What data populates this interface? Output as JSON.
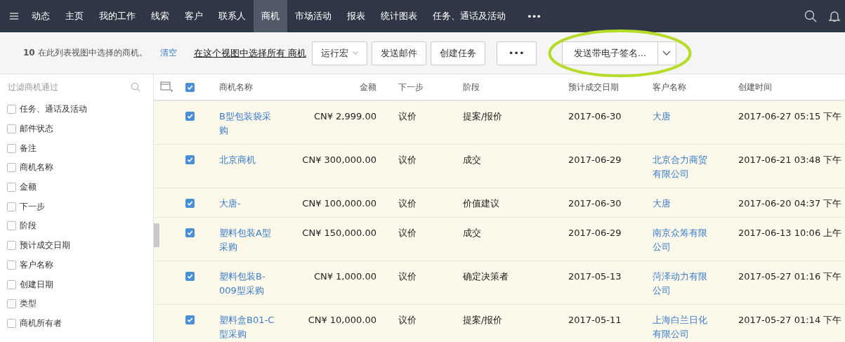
{
  "nav": {
    "items": [
      {
        "label": "动态",
        "selected": false
      },
      {
        "label": "主页",
        "selected": false
      },
      {
        "label": "我的工作",
        "selected": false
      },
      {
        "label": "线索",
        "selected": false
      },
      {
        "label": "客户",
        "selected": false
      },
      {
        "label": "联系人",
        "selected": false
      },
      {
        "label": "商机",
        "selected": true
      },
      {
        "label": "市场活动",
        "selected": false
      },
      {
        "label": "报表",
        "selected": false
      },
      {
        "label": "统计图表",
        "selected": false
      },
      {
        "label": "任务、通话及活动",
        "selected": false
      }
    ],
    "more": "•••"
  },
  "toolbar": {
    "selection_text": "**10** 在此列表视图中选择的商机。",
    "clear_link": "清空",
    "select_all_link": "在这个视图中选择所有 商机",
    "buttons": [
      {
        "label": "运行宏",
        "kind": "dropdown"
      },
      {
        "label": "发送邮件",
        "kind": "plain"
      },
      {
        "label": "创建任务",
        "kind": "plain"
      },
      {
        "label": "•••",
        "kind": "more"
      },
      {
        "label": "发送带电子签名...",
        "kind": "split"
      }
    ]
  },
  "sidebar": {
    "filter_placeholder": "过滤商机通过",
    "fields": [
      {
        "label": "任务、通话及活动",
        "checked": false
      },
      {
        "label": "邮件状态",
        "checked": false
      },
      {
        "label": "备注",
        "checked": false
      },
      {
        "label": "商机名称",
        "checked": false
      },
      {
        "label": "金额",
        "checked": false
      },
      {
        "label": "下一步",
        "checked": false
      },
      {
        "label": "阶段",
        "checked": false
      },
      {
        "label": "预计成交日期",
        "checked": false
      },
      {
        "label": "客户名称",
        "checked": false
      },
      {
        "label": "创建日期",
        "checked": false
      },
      {
        "label": "类型",
        "checked": false
      },
      {
        "label": "商机所有者",
        "checked": false
      }
    ]
  },
  "table": {
    "all_checked": true,
    "columns": [
      "商机名称",
      "金额",
      "下一步",
      "阶段",
      "预计成交日期",
      "客户名称",
      "创建时间"
    ],
    "rows": [
      {
        "checked": true,
        "name": "B型包装袋采购",
        "amount": "CN¥ 2,999.00",
        "next_step": "议价",
        "stage": "提案/报价",
        "close_date": "2017-06-30",
        "customer": "大唐",
        "created": "2017-06-27 05:15 下午"
      },
      {
        "checked": true,
        "name": "北京商机",
        "amount": "CN¥ 300,000.00",
        "next_step": "议价",
        "stage": "成交",
        "close_date": "2017-06-29",
        "customer": "北京合力商贸有限公司",
        "created": "2017-06-21 03:48 下午"
      },
      {
        "checked": true,
        "name": "大唐-",
        "amount": "CN¥ 100,000.00",
        "next_step": "议价",
        "stage": "价值建议",
        "close_date": "2017-06-30",
        "customer": "大唐",
        "created": "2017-06-20 04:37 下午"
      },
      {
        "checked": true,
        "name": "塑料包装A型采购",
        "amount": "CN¥ 150,000.00",
        "next_step": "议价",
        "stage": "成交",
        "close_date": "2017-06-29",
        "customer": "南京众筹有限公司",
        "created": "2017-06-13 10:06 上午"
      },
      {
        "checked": true,
        "name": "塑料包装B-009型采购",
        "amount": "CN¥ 1,000.00",
        "next_step": "议价",
        "stage": "确定决策者",
        "close_date": "2017-05-13",
        "customer": "菏泽动力有限公司",
        "created": "2017-05-27 01:16 下午"
      },
      {
        "checked": true,
        "name": "塑料盒B01-C型采购",
        "amount": "CN¥ 10,000.00",
        "next_step": "议价",
        "stage": "提案/报价",
        "close_date": "2017-05-11",
        "customer": "上海白兰日化有限公司",
        "created": "2017-05-27 01:14 下午"
      }
    ]
  }
}
